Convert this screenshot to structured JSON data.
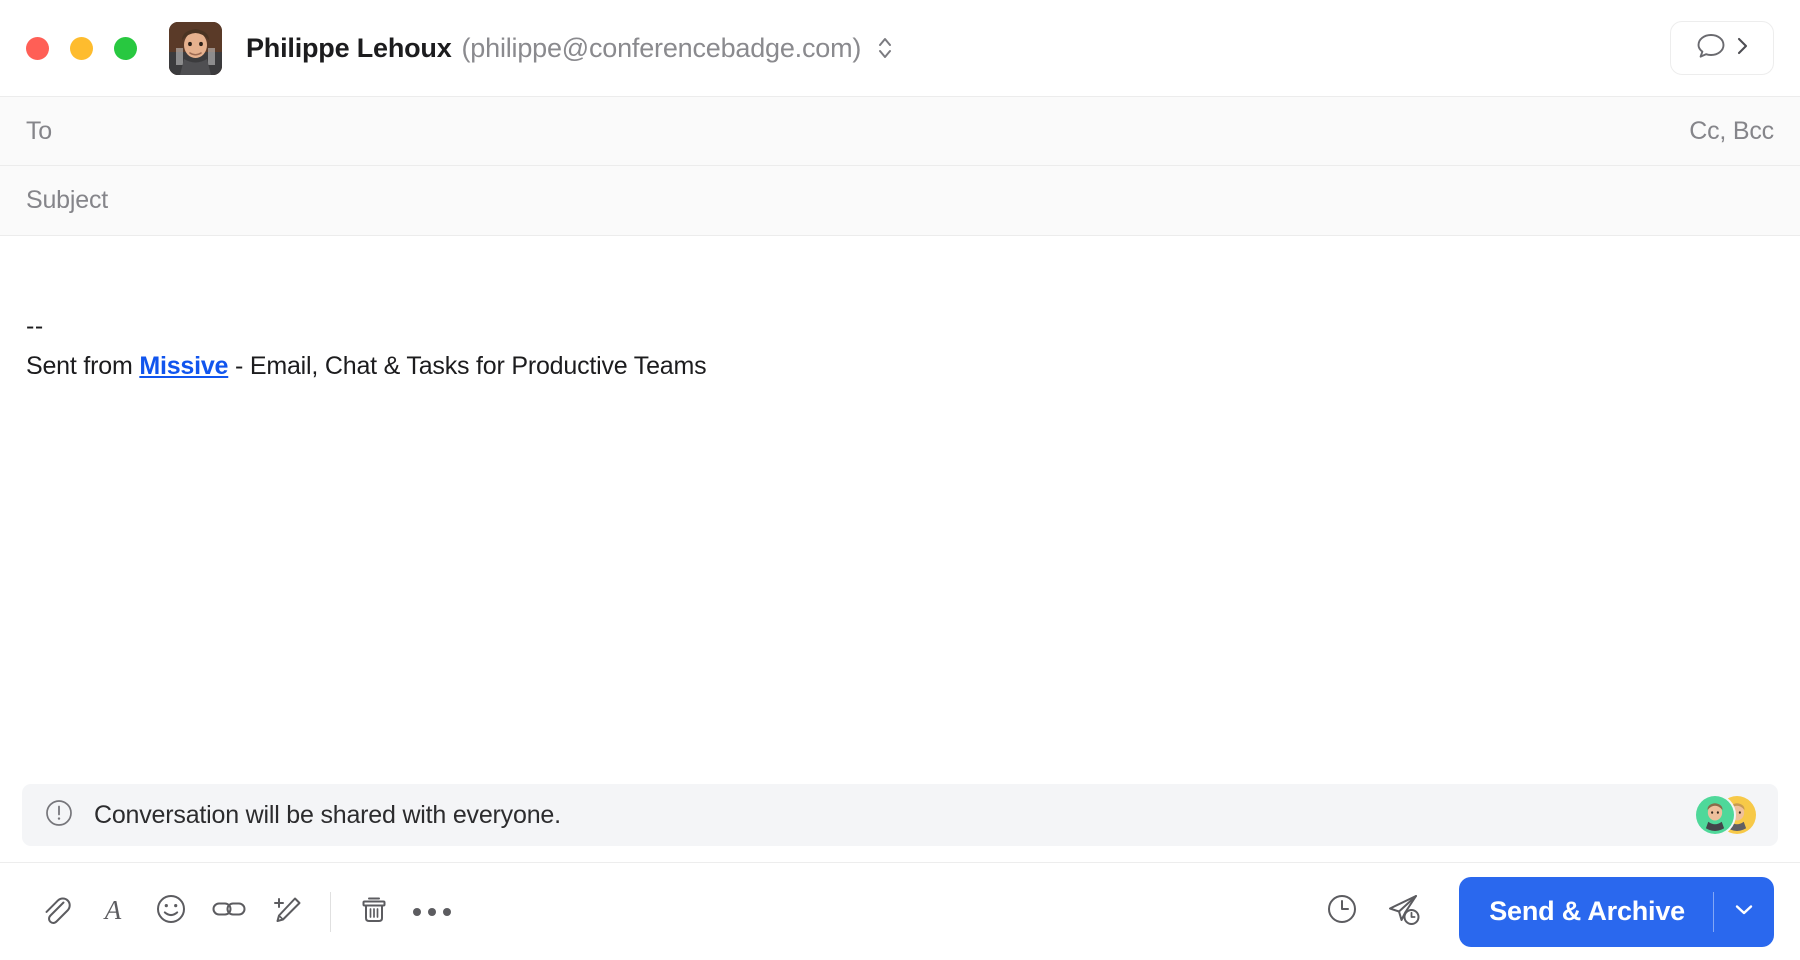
{
  "window": {
    "traffic_lights": [
      {
        "name": "close",
        "color": "#ff5f56"
      },
      {
        "name": "minimize",
        "color": "#febc2e"
      },
      {
        "name": "maximize",
        "color": "#28c840"
      }
    ]
  },
  "header": {
    "sender_name": "Philippe Lehoux",
    "sender_email": "(philippe@conferencebadge.com)",
    "account_switch_icon": "chevron-up-down-icon",
    "avatar_icon": "sender-avatar",
    "chat_toggle": {
      "icon": "chat-bubble-icon",
      "chevron": "chevron-right-icon"
    }
  },
  "fields": {
    "to": {
      "label": "To",
      "value": "",
      "placeholder": "To"
    },
    "cc_bcc": "Cc, Bcc",
    "subject": {
      "label": "Subject",
      "value": "",
      "placeholder": "Subject"
    }
  },
  "body": {
    "signature_separator": "--",
    "signature_prefix": "Sent from ",
    "signature_link": "Missive",
    "signature_suffix": " - Email, Chat & Tasks for Productive Teams",
    "link_color": "#1155ee"
  },
  "notice": {
    "icon": "exclamation-circle-icon",
    "text": "Conversation will be shared with everyone.",
    "background": "#f4f5f7",
    "avatars": [
      {
        "name": "participant-avatar-1",
        "ring_color": "#4fd89a"
      },
      {
        "name": "participant-avatar-2",
        "ring_color": "#f7c948"
      }
    ]
  },
  "toolbar": {
    "left_items": [
      {
        "name": "attach-file-button",
        "icon": "paperclip-icon"
      },
      {
        "name": "text-format-button",
        "icon": "font-a-icon"
      },
      {
        "name": "emoji-button",
        "icon": "smiley-icon"
      },
      {
        "name": "insert-link-button",
        "icon": "link-icon"
      },
      {
        "name": "signature-button",
        "icon": "pencil-plus-icon"
      }
    ],
    "after_separator_items": [
      {
        "name": "delete-draft-button",
        "icon": "trash-icon"
      },
      {
        "name": "more-options-button",
        "icon": "ellipsis-icon"
      }
    ],
    "right_items": [
      {
        "name": "schedule-button",
        "icon": "clock-icon"
      },
      {
        "name": "send-later-button",
        "icon": "send-later-icon"
      }
    ],
    "send": {
      "label": "Send & Archive",
      "caret_icon": "chevron-down-icon",
      "color": "#2a68ee"
    }
  }
}
